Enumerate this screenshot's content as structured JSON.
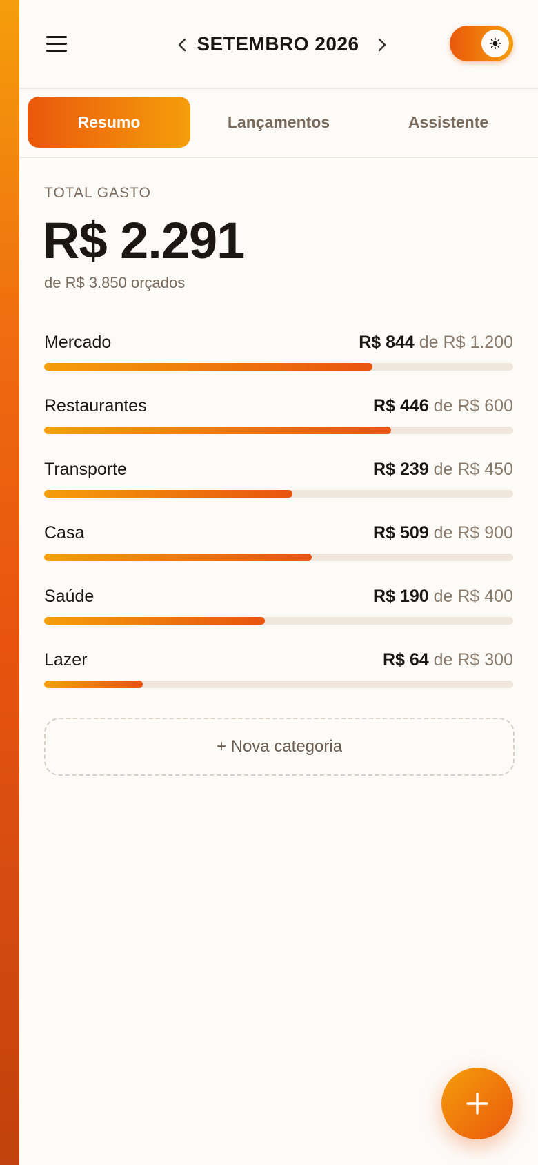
{
  "header": {
    "month_label": "SETEMBRO 2026",
    "menu_icon": "hamburger-menu-icon",
    "prev_icon": "chevron-left-icon",
    "next_icon": "chevron-right-icon",
    "theme_icon": "sun-icon"
  },
  "tabs": [
    {
      "label": "Resumo",
      "active": true
    },
    {
      "label": "Lançamentos",
      "active": false
    },
    {
      "label": "Assistente",
      "active": false
    }
  ],
  "summary": {
    "total_label": "TOTAL GASTO",
    "total_value": "R$ 2.291",
    "budget_text": "de R$ 3.850 orçados"
  },
  "categories": [
    {
      "name": "Mercado",
      "spent": "R$ 844",
      "of_budget": "de R$ 1.200",
      "progress": 0.7
    },
    {
      "name": "Restaurantes",
      "spent": "R$ 446",
      "of_budget": "de R$ 600",
      "progress": 0.74
    },
    {
      "name": "Transporte",
      "spent": "R$ 239",
      "of_budget": "de R$ 450",
      "progress": 0.53
    },
    {
      "name": "Casa",
      "spent": "R$ 509",
      "of_budget": "de R$ 900",
      "progress": 0.57
    },
    {
      "name": "Saúde",
      "spent": "R$ 190",
      "of_budget": "de R$ 400",
      "progress": 0.47
    },
    {
      "name": "Lazer",
      "spent": "R$ 64",
      "of_budget": "de R$ 300",
      "progress": 0.21
    }
  ],
  "new_category_label": "+ Nova categoria",
  "fab_icon": "plus-icon",
  "colors": {
    "accent_start": "#f59e0b",
    "accent_end": "#ea580c",
    "background": "#fdfbf8",
    "track": "#f0e6dc"
  }
}
